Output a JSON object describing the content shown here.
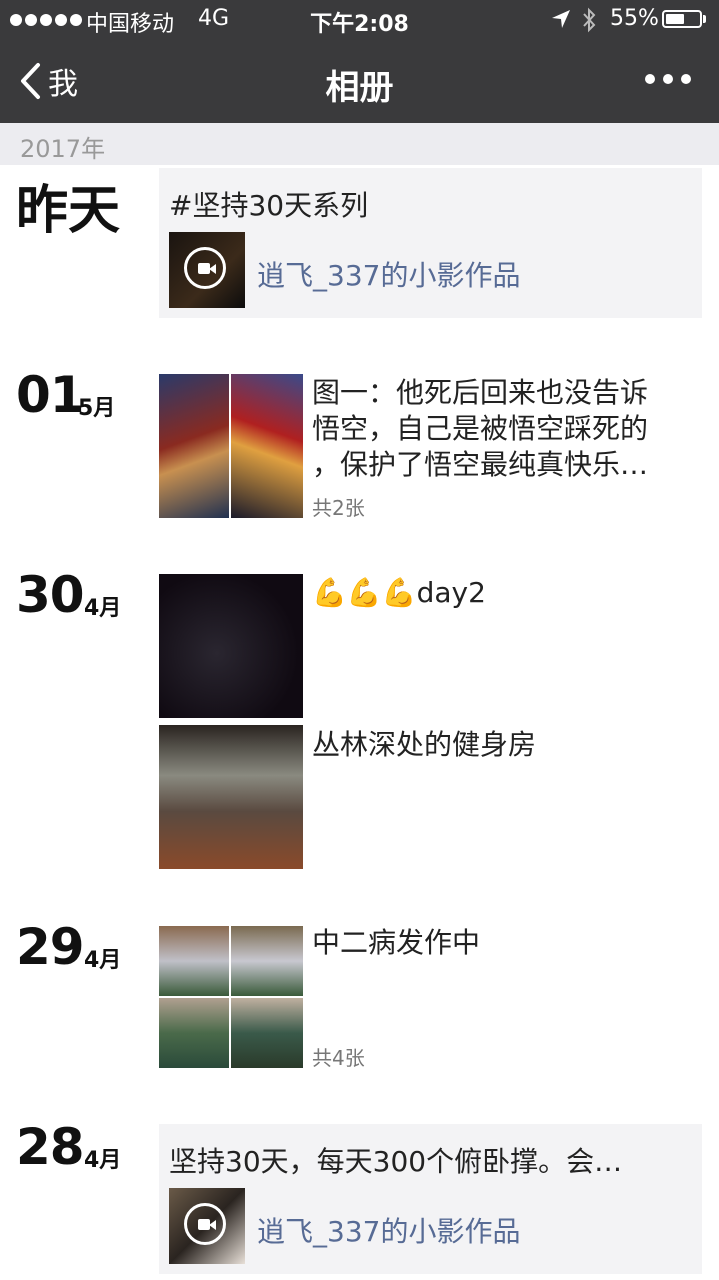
{
  "status_bar": {
    "carrier": "中国移动",
    "network": "4G",
    "time": "下午2:08",
    "battery_percent": "55%",
    "battery_level": 0.55
  },
  "nav": {
    "back_label": "我",
    "title": "相册"
  },
  "year_header": "2017年",
  "entries": [
    {
      "day": "昨天",
      "card_text": "#坚持30天系列",
      "link": "逍飞_337的小影作品"
    },
    {
      "day": "01",
      "month": "5月",
      "text_lines": [
        "图一：他死后回来也没告诉",
        "悟空，自己是被悟空踩死的",
        "，保护了悟空最纯真快乐…"
      ],
      "count": "共2张"
    },
    {
      "day": "30",
      "month": "4月",
      "posts": [
        {
          "text": "day2",
          "emoji": "💪💪💪"
        },
        {
          "text": "丛林深处的健身房"
        }
      ]
    },
    {
      "day": "29",
      "month": "4月",
      "text": "中二病发作中",
      "count": "共4张"
    },
    {
      "day": "28",
      "month": "4月",
      "card_text": "坚持30天，每天300个俯卧撑。会…",
      "link": "逍飞_337的小影作品"
    }
  ],
  "colors": {
    "nav_bg": "#3a3a3c",
    "link": "#576b95",
    "card_bg": "#f3f3f5",
    "emoji": "#f4b21b"
  }
}
